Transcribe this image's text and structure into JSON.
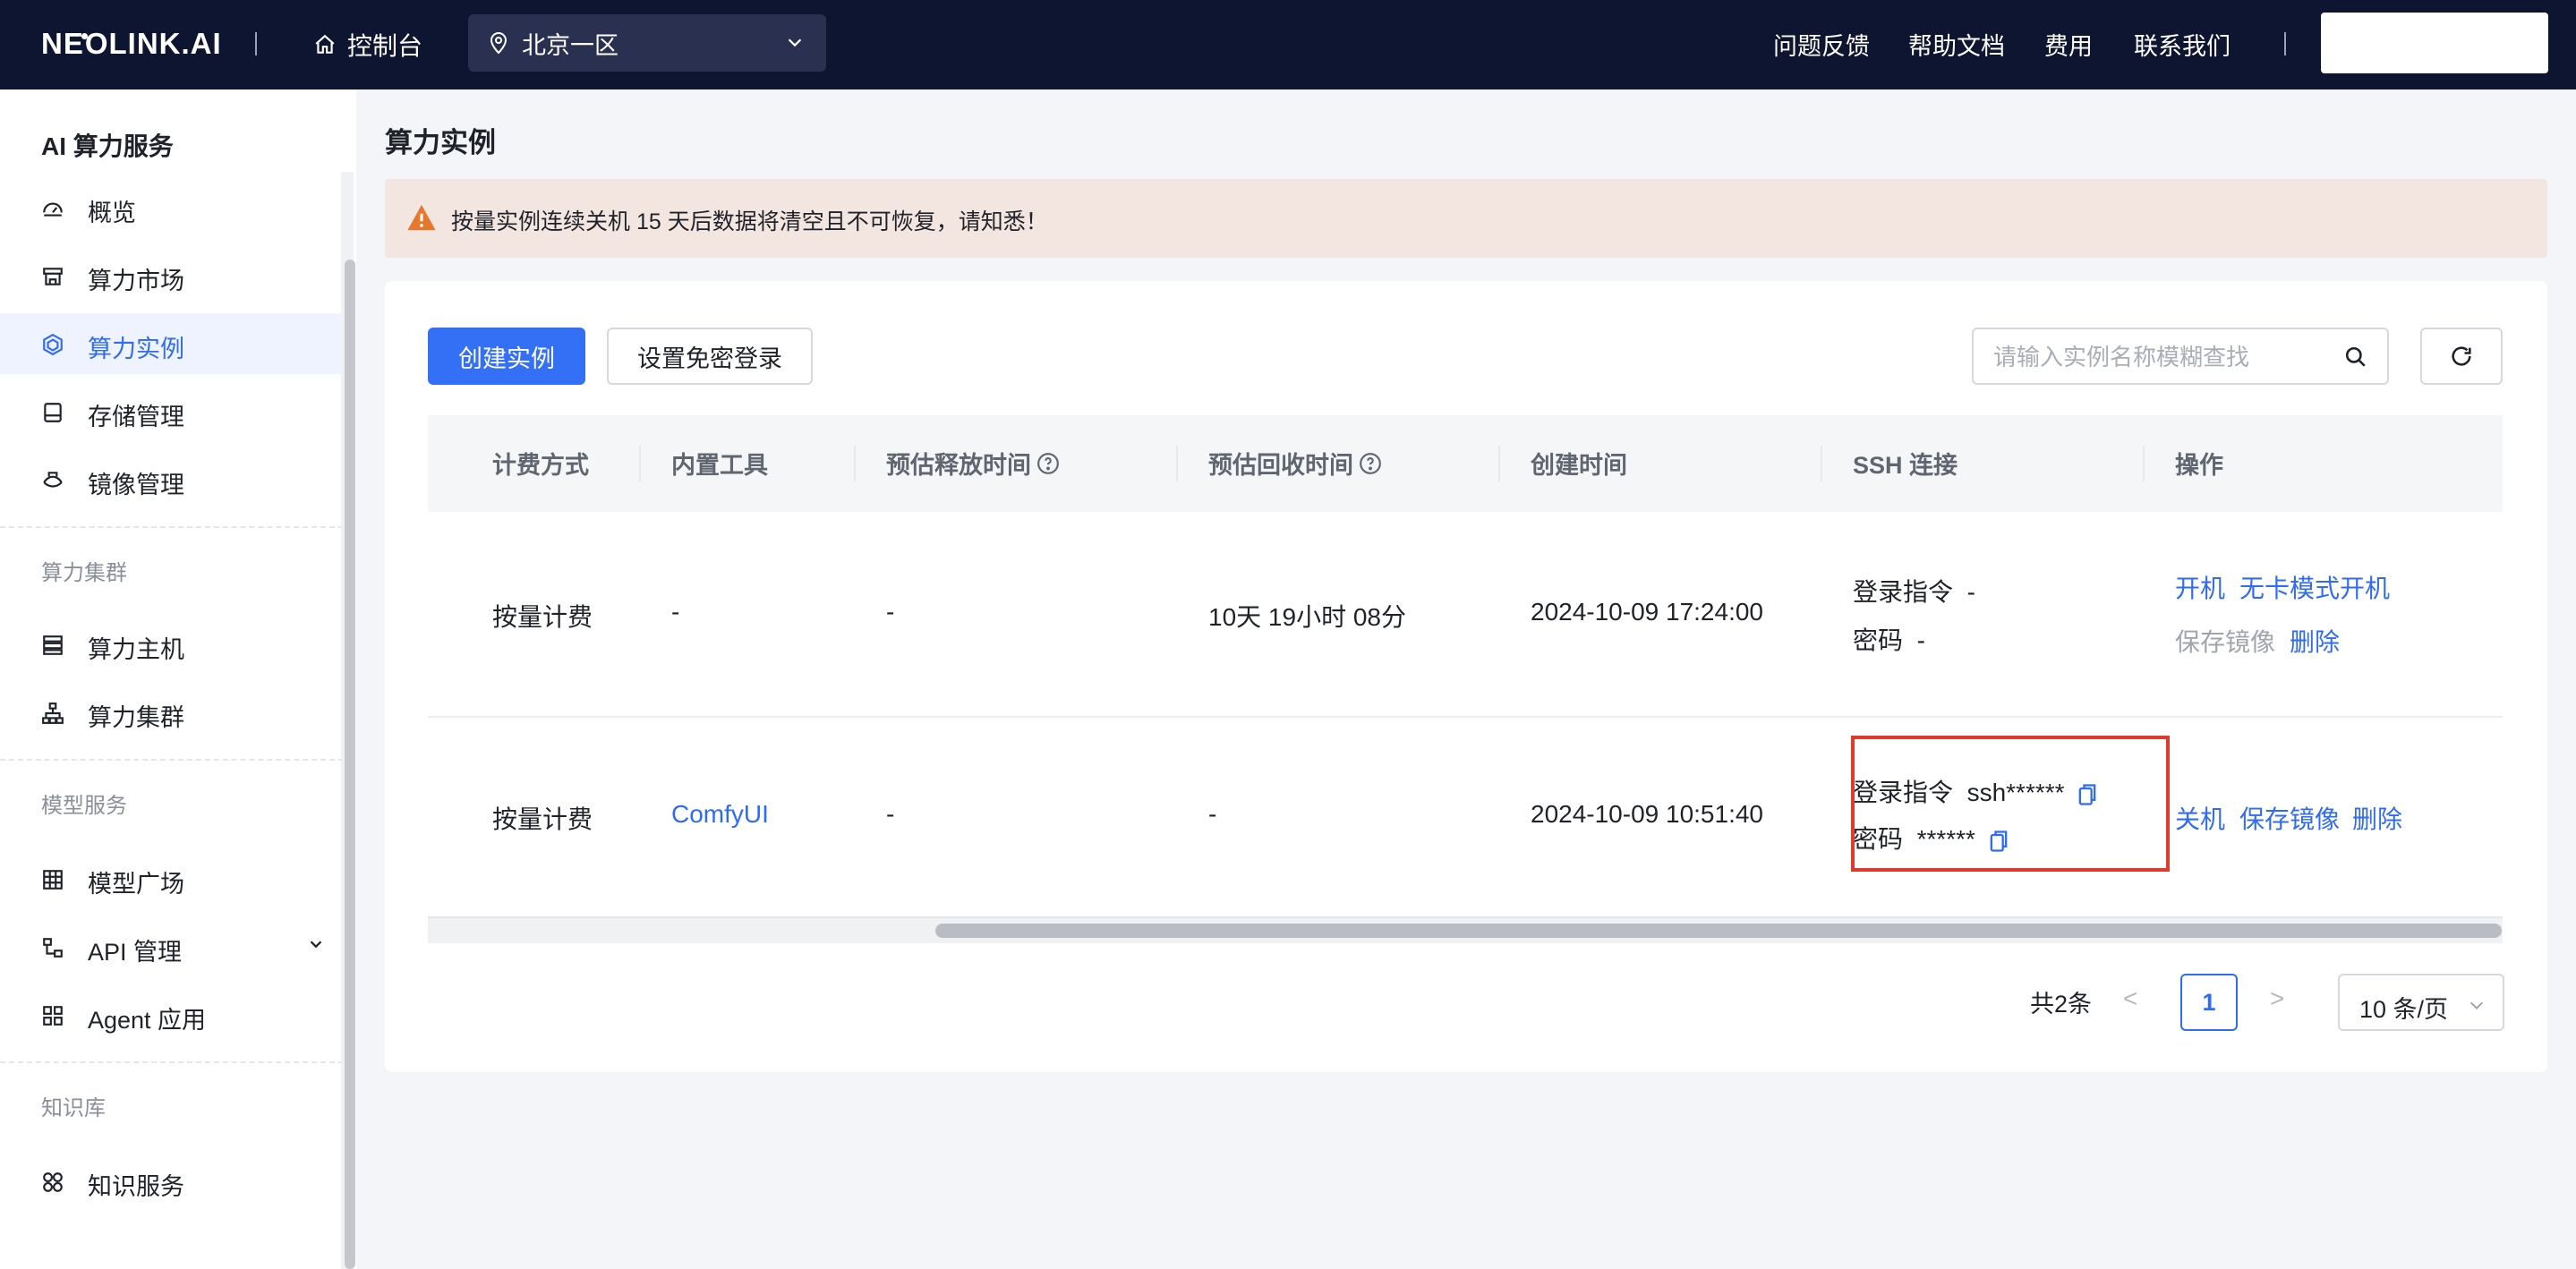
{
  "header": {
    "logo": "NE LINK.AI",
    "console_label": "控制台",
    "region": "北京一区",
    "nav": [
      "问题反馈",
      "帮助文档",
      "费用",
      "联系我们"
    ]
  },
  "sidebar": {
    "title": "AI 算力服务",
    "items_ai": [
      {
        "label": "概览",
        "icon": "gauge-icon"
      },
      {
        "label": "算力市场",
        "icon": "store-icon"
      },
      {
        "label": "算力实例",
        "icon": "instance-icon",
        "active": true
      },
      {
        "label": "存储管理",
        "icon": "storage-icon"
      },
      {
        "label": "镜像管理",
        "icon": "image-icon"
      }
    ],
    "group_cluster": "算力集群",
    "items_cluster": [
      {
        "label": "算力主机",
        "icon": "server-icon"
      },
      {
        "label": "算力集群",
        "icon": "cluster-icon"
      }
    ],
    "group_model": "模型服务",
    "items_model": [
      {
        "label": "模型广场",
        "icon": "model-square-icon"
      },
      {
        "label": "API 管理",
        "icon": "api-icon"
      },
      {
        "label": "Agent 应用",
        "icon": "agent-icon"
      }
    ],
    "group_kb": "知识库",
    "items_kb": [
      {
        "label": "知识服务",
        "icon": "knowledge-icon"
      }
    ]
  },
  "page": {
    "title": "算力实例",
    "alert": "按量实例连续关机 15 天后数据将清空且不可恢复，请知悉！",
    "create_button": "创建实例",
    "passwordless_button": "设置免密登录",
    "search_placeholder": "请输入实例名称模糊查找"
  },
  "table": {
    "columns": [
      "计费方式",
      "内置工具",
      "预估释放时间",
      "预估回收时间",
      "创建时间",
      "SSH 连接",
      "操作"
    ],
    "rows": [
      {
        "billing": "按量计费",
        "tool": "-",
        "release_time": "-",
        "recycle_time": "10天 19小时 08分",
        "created": "2024-10-09 17:24:00",
        "ssh_login_label": "登录指令",
        "ssh_login_value": "-",
        "ssh_pwd_label": "密码",
        "ssh_pwd_value": "-",
        "actions": [
          "开机",
          "无卡模式开机",
          "保存镜像",
          "删除"
        ]
      },
      {
        "billing": "按量计费",
        "tool": "ComfyUI",
        "release_time": "-",
        "recycle_time": "-",
        "created": "2024-10-09 10:51:40",
        "ssh_login_label": "登录指令",
        "ssh_login_value": "ssh******",
        "ssh_pwd_label": "密码",
        "ssh_pwd_value": "******",
        "actions": [
          "关机",
          "保存镜像",
          "删除"
        ]
      }
    ]
  },
  "pagination": {
    "total": "共2条",
    "prev": "<",
    "current": "1",
    "next": ">",
    "page_size": "10 条/页"
  },
  "colors": {
    "primary": "#3370f5",
    "topbar": "#0e1530",
    "alert_bg": "#f3e6e0",
    "warning": "#e8772e",
    "highlight": "#e03a2f"
  }
}
